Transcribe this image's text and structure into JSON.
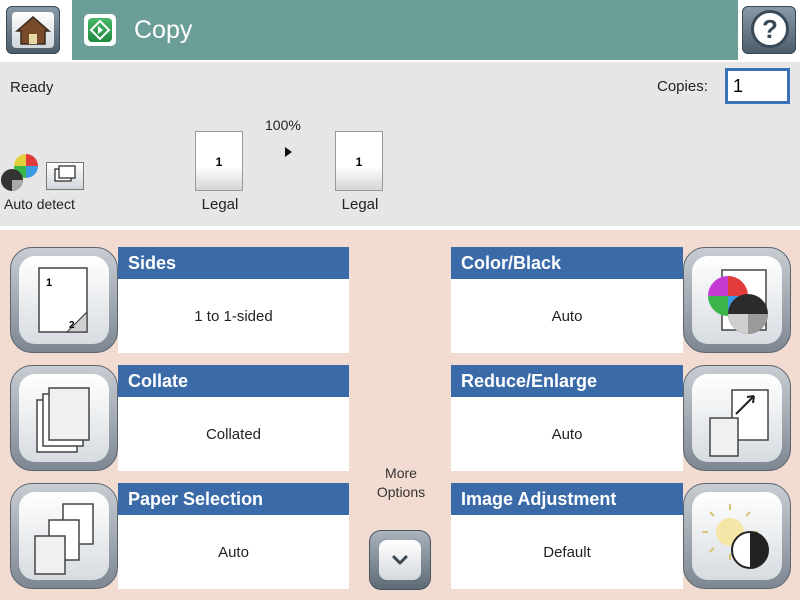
{
  "app": {
    "title": "Copy"
  },
  "header": {
    "home_icon": "home-icon",
    "start_icon": "start-copy-icon",
    "help_icon": "help-icon",
    "help_glyph": "?"
  },
  "status": {
    "text": "Ready",
    "copies_label": "Copies:",
    "copies_value": "1",
    "zoom": "100%",
    "original_page_number": "1",
    "original_size": "Legal",
    "output_page_number": "1",
    "output_size": "Legal",
    "color_mode": "Auto detect"
  },
  "tiles": [
    {
      "title": "Sides",
      "value": "1 to 1-sided",
      "icon": "sides-icon"
    },
    {
      "title": "Collate",
      "value": "Collated",
      "icon": "collate-icon"
    },
    {
      "title": "Paper Selection",
      "value": "Auto",
      "icon": "paper-selection-icon"
    },
    {
      "title": "Color/Black",
      "value": "Auto",
      "icon": "color-black-icon"
    },
    {
      "title": "Reduce/Enlarge",
      "value": "Auto",
      "icon": "reduce-enlarge-icon"
    },
    {
      "title": "Image Adjustment",
      "value": "Default",
      "icon": "image-adjustment-icon"
    }
  ],
  "more_options": {
    "label": "More Options",
    "icon": "chevron-down-icon"
  },
  "colors": {
    "title_bar": "#6c9e98",
    "tile_header": "#3a6aa8",
    "main_background": "#f2dbd1",
    "status_background": "#e6e6e6"
  }
}
